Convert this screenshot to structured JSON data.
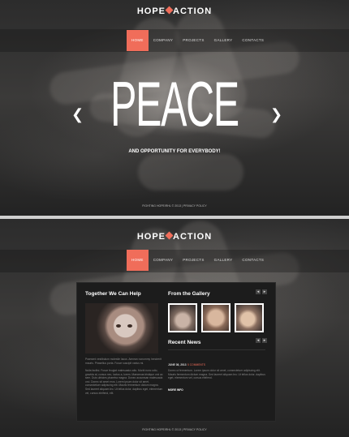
{
  "site": {
    "logo_left": "HOPE",
    "logo_right": "ACTION"
  },
  "menu": {
    "items": [
      "HOME",
      "COMPANY",
      "PROJECTS",
      "GALLERY",
      "CONTACTS"
    ]
  },
  "hero": {
    "title": "PEACE",
    "subtitle": "AND OPPORTUNITY FOR EVERYBODY!",
    "prev": "❮",
    "next": "❯"
  },
  "footer": {
    "text": "FIGHTING HOPE/RHL  © 2013  |  PRIVACY POLICY"
  },
  "help": {
    "title": "Together We Can Help",
    "para1": "Praesent vestibulum molestie lacus. Aenean nonummy hendrerit mauris. Phasellus porta. Fusce suscipit varius mi.",
    "para2": "Nulla facilisi. Fusce feugiat malesuada odio. Morbi nunc odio, gravida at, cursus nec, luctus a, lorem. Maecenas tristique orci ac sem. Duis ultricies pharetra magna. Donec accumsan malesuada orci. Donec sit amet eros. Lorem ipsum dolor sit amet, consectetuer adipiscing elit. Mauris fermentum dictum magna. Sed laoreet aliquam leo. Ut tellus dolor, dapibus eget, elementum vel, cursus eleifend, elit."
  },
  "gallery": {
    "title": "From the Gallery",
    "prev": "◂",
    "next": "▸"
  },
  "news": {
    "title": "Recent News",
    "date": "JUNE 08, 2013",
    "comments": "5 COMMENTS",
    "text": "Donec ut fermentum. Lorem ipsum dolor sit amet, consectetuer adipiscing elit. Mauris fermentum dictum magna. Sed laoreet aliquam leo. Ut tellus dolor, dapibus eget, elementum vel, cursus eleifend.",
    "more": "MORE INFO"
  },
  "colors": {
    "accent": "#f06d5a",
    "content_bg": "#1c1c1c"
  }
}
